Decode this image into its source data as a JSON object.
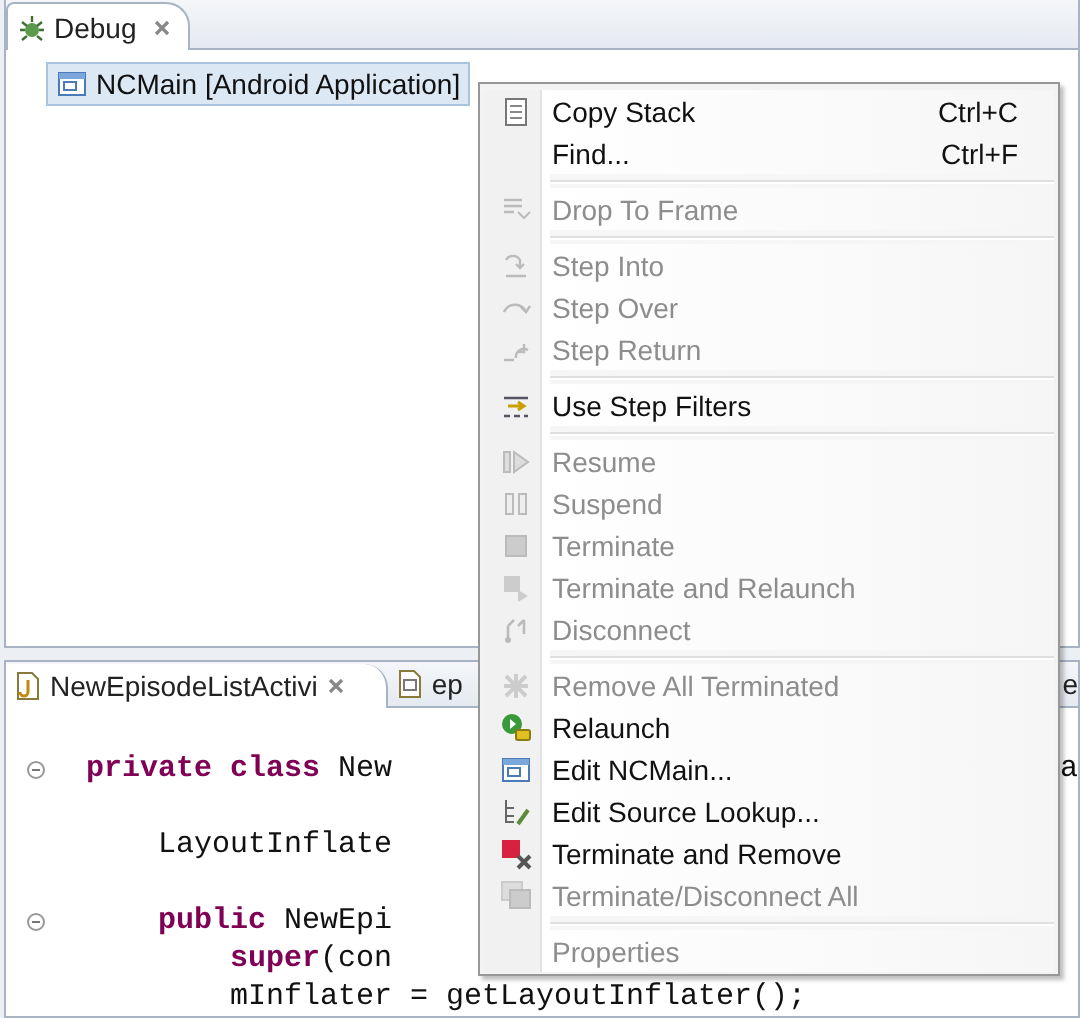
{
  "debug_view": {
    "tab": {
      "label": "Debug",
      "selected": true
    },
    "tree": [
      {
        "label": "NCMain [Android Application]",
        "selected": true
      }
    ]
  },
  "editor": {
    "tabs": [
      {
        "label": "NewEpisodeListActivi",
        "selected": true
      },
      {
        "label": "ep",
        "selected": false
      },
      {
        "label": "e",
        "selected": false
      }
    ],
    "lines": [
      {
        "kind": "code",
        "fold": true,
        "segments": [
          {
            "kind": "keyword",
            "text": "private class"
          },
          {
            "kind": "plain",
            "text": " New"
          }
        ],
        "tail": "a"
      },
      {
        "kind": "blank"
      },
      {
        "kind": "code",
        "fold": false,
        "segments": [
          {
            "kind": "plain",
            "text": "    LayoutInflate"
          }
        ]
      },
      {
        "kind": "blank"
      },
      {
        "kind": "code",
        "fold": true,
        "segments": [
          {
            "kind": "keyword",
            "text": "    public"
          },
          {
            "kind": "plain",
            "text": " NewEpi"
          }
        ]
      },
      {
        "kind": "code",
        "fold": false,
        "segments": [
          {
            "kind": "keyword",
            "text": "        super"
          },
          {
            "kind": "plain",
            "text": "(con"
          }
        ]
      },
      {
        "kind": "code",
        "fold": false,
        "segments": [
          {
            "kind": "plain",
            "text": "        mInflater = getLayoutInflater();"
          }
        ]
      }
    ]
  },
  "context_menu": {
    "items": [
      {
        "kind": "item",
        "label": "Copy Stack",
        "shortcut": "Ctrl+C",
        "disabled": false
      },
      {
        "kind": "item",
        "label": "Find...",
        "shortcut": "Ctrl+F",
        "disabled": false
      },
      {
        "kind": "separator"
      },
      {
        "kind": "item",
        "label": "Drop To Frame",
        "disabled": true
      },
      {
        "kind": "separator"
      },
      {
        "kind": "item",
        "label": "Step Into",
        "disabled": true
      },
      {
        "kind": "item",
        "label": "Step Over",
        "disabled": true
      },
      {
        "kind": "item",
        "label": "Step Return",
        "disabled": true
      },
      {
        "kind": "separator"
      },
      {
        "kind": "item",
        "label": "Use Step Filters",
        "disabled": false
      },
      {
        "kind": "separator"
      },
      {
        "kind": "item",
        "label": "Resume",
        "disabled": true
      },
      {
        "kind": "item",
        "label": "Suspend",
        "disabled": true
      },
      {
        "kind": "item",
        "label": "Terminate",
        "disabled": true
      },
      {
        "kind": "item",
        "label": "Terminate and Relaunch",
        "disabled": true
      },
      {
        "kind": "item",
        "label": "Disconnect",
        "disabled": true
      },
      {
        "kind": "separator"
      },
      {
        "kind": "item",
        "label": "Remove All Terminated",
        "disabled": true
      },
      {
        "kind": "item",
        "label": "Relaunch",
        "disabled": false
      },
      {
        "kind": "item",
        "label": "Edit NCMain...",
        "disabled": false
      },
      {
        "kind": "item",
        "label": "Edit Source Lookup...",
        "disabled": false
      },
      {
        "kind": "item",
        "label": "Terminate and Remove",
        "disabled": false
      },
      {
        "kind": "item",
        "label": "Terminate/Disconnect All",
        "disabled": true
      },
      {
        "kind": "separator"
      },
      {
        "kind": "item",
        "label": "Properties",
        "disabled": true
      }
    ]
  }
}
